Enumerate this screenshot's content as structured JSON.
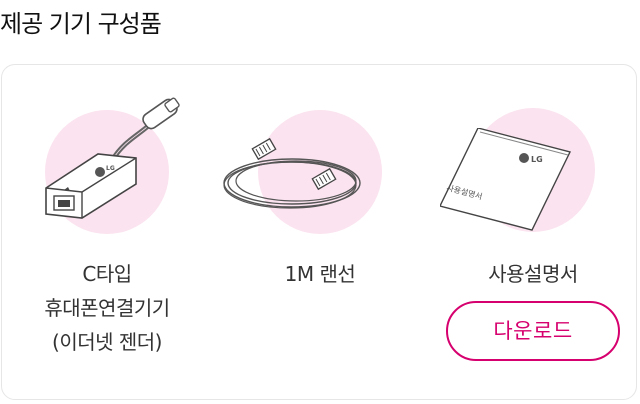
{
  "section": {
    "title": "제공 기기 구성품"
  },
  "items": [
    {
      "label": "C타입\n휴대폰연결기기\n(이더넷 젠더)",
      "icon": "usb-c-ethernet-adapter-icon"
    },
    {
      "label": "1M 랜선",
      "icon": "lan-cable-icon"
    },
    {
      "label": "사용설명서",
      "icon": "manual-booklet-icon"
    }
  ],
  "manual": {
    "brand": "LG",
    "cover_text": "사용설명서"
  },
  "download": {
    "label": "다운로드"
  },
  "colors": {
    "accent": "#d6006e",
    "circle": "#fbe3ef",
    "border": "#e6e6e6"
  }
}
